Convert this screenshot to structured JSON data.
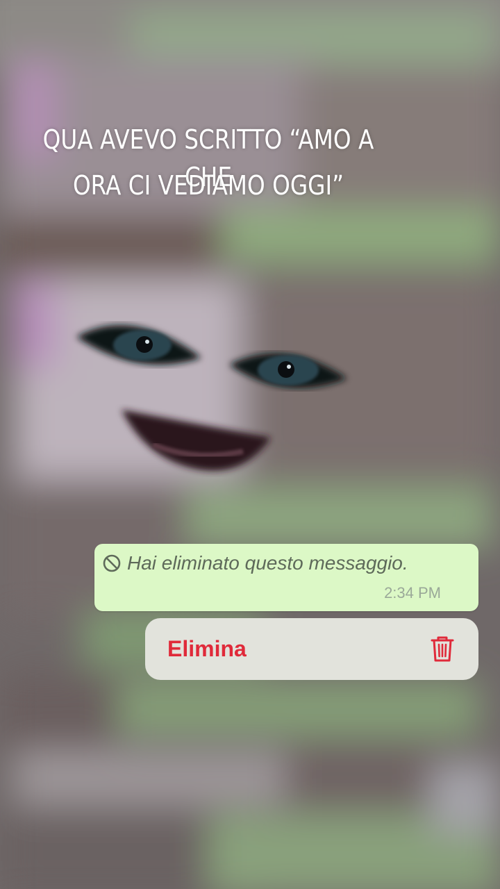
{
  "story": {
    "caption_line_1": "QUA AVEVO SCRITTO “AMO A CHE",
    "caption_line_2": "ORA CI VEDIAMO OGGI”"
  },
  "message": {
    "deleted_text": "Hai eliminato questo messaggio.",
    "time": "2:34 PM",
    "bubble_color": "#dcf8c6"
  },
  "context_menu": {
    "delete_label": "Elimina",
    "delete_color": "#e02a3a",
    "icon": "trash-icon"
  }
}
